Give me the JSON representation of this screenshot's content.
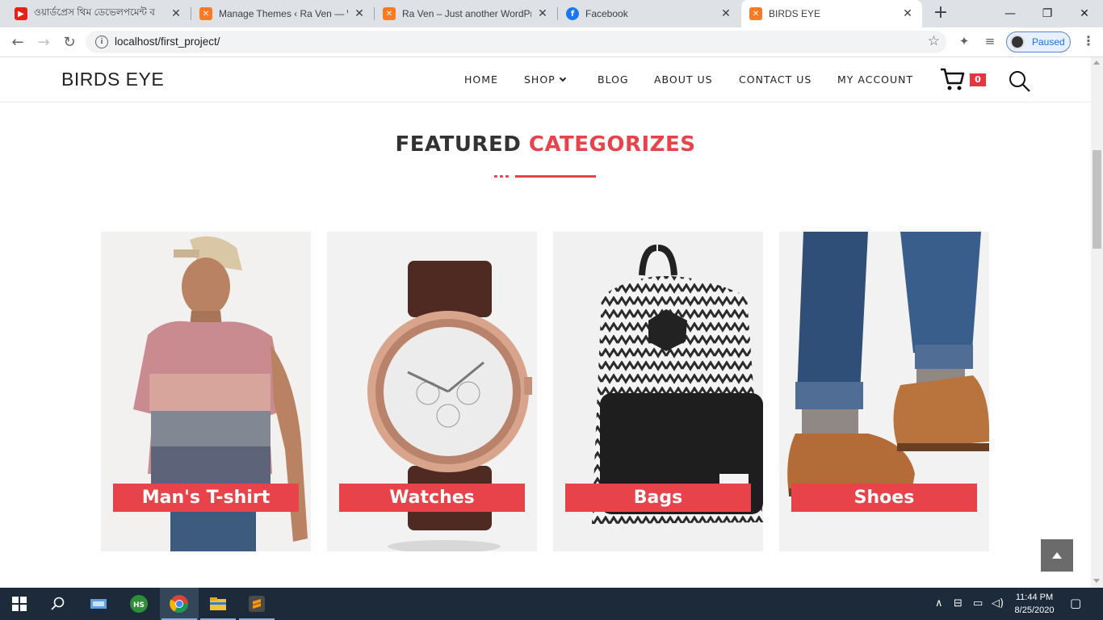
{
  "browser": {
    "tabs": [
      {
        "title": "ওয়ার্ডপ্রেস থিম ডেভেলপমেন্ট ব",
        "favicon": "youtube-icon",
        "active": false
      },
      {
        "title": "Manage Themes ‹ Ra Ven — W",
        "favicon": "xampp-icon",
        "active": false
      },
      {
        "title": "Ra Ven – Just another WordPre",
        "favicon": "xampp-icon",
        "active": false
      },
      {
        "title": "Facebook",
        "favicon": "facebook-icon",
        "active": false
      },
      {
        "title": "BIRDS EYE",
        "favicon": "xampp-icon",
        "active": true
      }
    ],
    "new_tab": "+",
    "url": "localhost/first_project/",
    "profile_label": "Paused"
  },
  "site": {
    "brand": "BIRDS EYE",
    "menu": [
      "HOME",
      "SHOP",
      "BLOG",
      "ABOUT US",
      "CONTACT US",
      "MY ACCOUNT"
    ],
    "cart_count": "0",
    "accent_color": "#e8434a"
  },
  "featured": {
    "title_plain": "FEATURED",
    "title_accent": "CATEGORIZES",
    "categories": [
      {
        "label": "Man's T-shirt",
        "image": "man-tshirt-photo"
      },
      {
        "label": "Watches",
        "image": "watch-photo"
      },
      {
        "label": "Bags",
        "image": "backpack-photo"
      },
      {
        "label": "Shoes",
        "image": "shoes-photo"
      }
    ]
  },
  "taskbar": {
    "time": "11:44 PM",
    "date": "8/25/2020"
  }
}
